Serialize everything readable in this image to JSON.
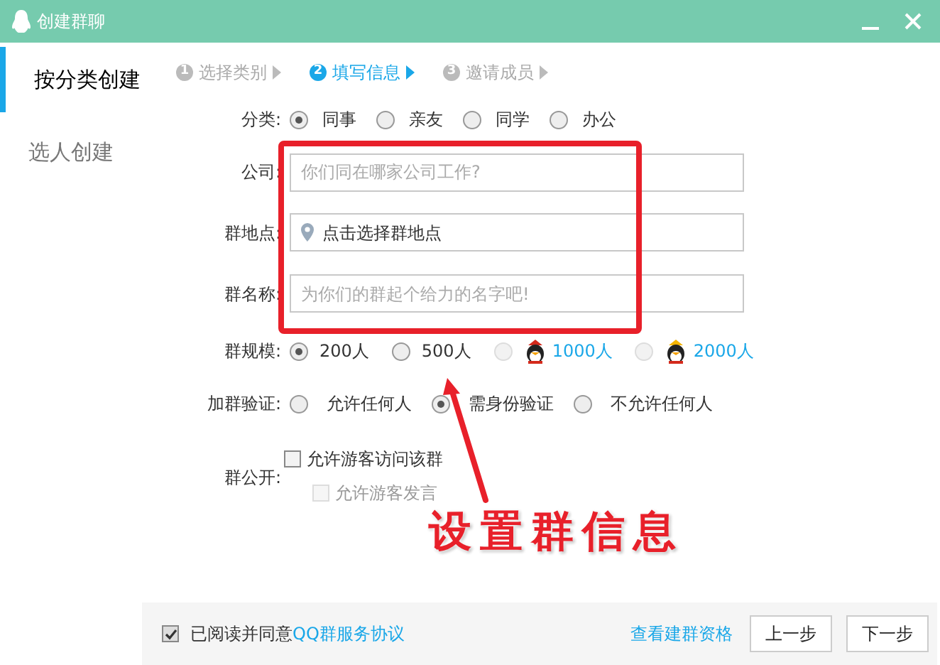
{
  "window": {
    "title": "创建群聊"
  },
  "sidebar": {
    "items": [
      {
        "label": "按分类创建",
        "selected": true
      },
      {
        "label": "选人创建",
        "selected": false
      }
    ]
  },
  "steps": [
    {
      "number": "1",
      "label": "选择类别",
      "selected": false
    },
    {
      "number": "2",
      "label": "填写信息",
      "selected": true
    },
    {
      "number": "3",
      "label": "邀请成员",
      "selected": false
    }
  ],
  "form": {
    "category": {
      "label": "分类:",
      "options": [
        {
          "label": "同事",
          "selected": true
        },
        {
          "label": "亲友",
          "selected": false
        },
        {
          "label": "同学",
          "selected": false
        },
        {
          "label": "办公",
          "selected": false
        }
      ]
    },
    "fields": [
      {
        "kind": "text",
        "label": "公司:",
        "placeholder": "你们同在哪家公司工作?"
      },
      {
        "kind": "location",
        "label": "群地点:",
        "value": "点击选择群地点"
      },
      {
        "kind": "text",
        "label": "群名称:",
        "placeholder": "为你们的群起个给力的名字吧!"
      }
    ],
    "size": {
      "label": "群规模:",
      "options": [
        {
          "kind": "plain",
          "label": "200人",
          "selected": true,
          "disabled": false
        },
        {
          "kind": "plain",
          "label": "500人",
          "selected": false,
          "disabled": false
        },
        {
          "kind": "vip-red",
          "label": "1000人",
          "selected": false,
          "disabled": true
        },
        {
          "kind": "vip-gold",
          "label": "2000人",
          "selected": false,
          "disabled": true
        }
      ]
    },
    "verification": {
      "label": "加群验证:",
      "options": [
        {
          "label": "允许任何人",
          "selected": false
        },
        {
          "label": "需身份验证",
          "selected": true
        },
        {
          "label": "不允许任何人",
          "selected": false
        }
      ]
    },
    "public": {
      "label": "群公开:",
      "checkboxes": [
        {
          "label": "允许游客访问该群",
          "checked": false,
          "disabled": false
        },
        {
          "label": "允许游客发言",
          "checked": false,
          "disabled": true
        }
      ]
    }
  },
  "footer": {
    "agreement": {
      "checked": true,
      "text": "已阅读并同意",
      "link": "QQ群服务协议"
    },
    "link": "查看建群资格",
    "buttons": [
      "上一步",
      "下一步"
    ]
  },
  "annotation": {
    "text": "设置群信息"
  }
}
